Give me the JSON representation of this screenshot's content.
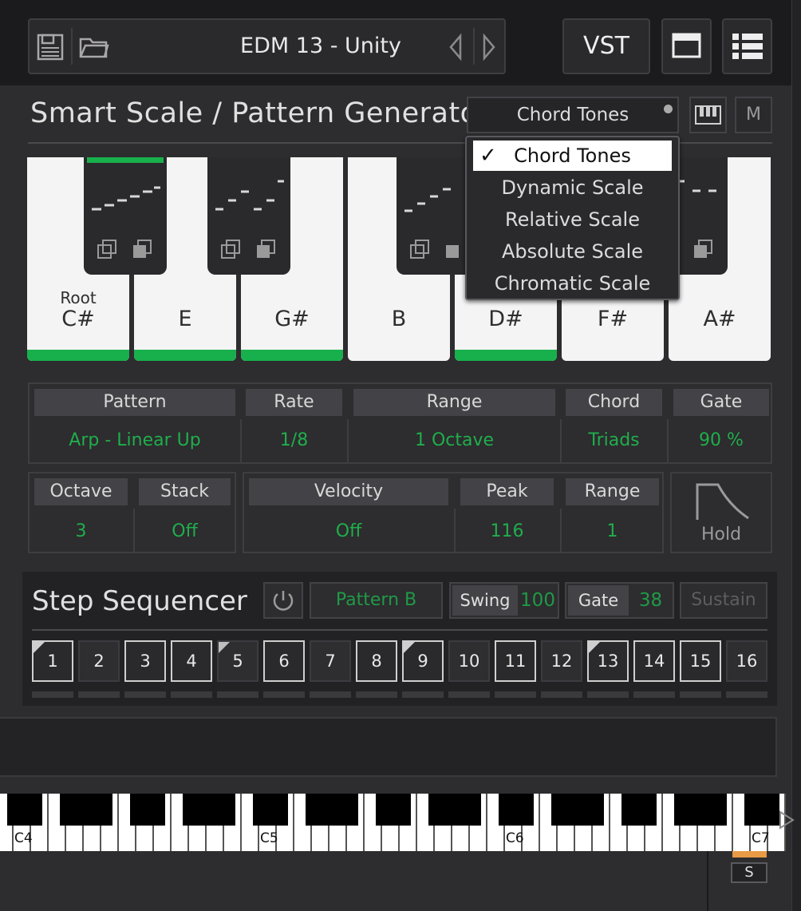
{
  "header": {
    "preset_name": "EDM 13 - Unity",
    "vst_label": "VST",
    "icons": [
      "save-icon",
      "folder-icon",
      "prev-arrow-icon",
      "next-arrow-icon",
      "window-icon",
      "list-icon"
    ]
  },
  "generator": {
    "title": "Smart Scale / Pattern Generator",
    "mode": "Chord Tones",
    "m_label": "M",
    "dropdown": [
      "Chord Tones",
      "Dynamic Scale",
      "Relative Scale",
      "Absolute Scale",
      "Chromatic Scale"
    ],
    "selected_index": 0,
    "check": "✓",
    "root_label": "Root",
    "keys": [
      {
        "note": "C#",
        "active": true
      },
      {
        "note": "E",
        "active": true
      },
      {
        "note": "G#",
        "active": true
      },
      {
        "note": "B",
        "active": false
      },
      {
        "note": "D#",
        "active": true
      },
      {
        "note": "F#",
        "active": false
      },
      {
        "note": "A#",
        "active": false
      }
    ],
    "accent_color": "#18b04c"
  },
  "params1": {
    "pattern": {
      "label": "Pattern",
      "value": "Arp - Linear Up"
    },
    "rate": {
      "label": "Rate",
      "value": "1/8"
    },
    "range": {
      "label": "Range",
      "value": "1 Octave"
    },
    "chord": {
      "label": "Chord",
      "value": "Triads"
    },
    "gate": {
      "label": "Gate",
      "value": "90 %"
    }
  },
  "params2": {
    "octave": {
      "label": "Octave",
      "value": "3"
    },
    "stack": {
      "label": "Stack",
      "value": "Off"
    },
    "velocity": {
      "label": "Velocity",
      "value": "Off"
    },
    "peak": {
      "label": "Peak",
      "value": "116"
    },
    "range": {
      "label": "Range",
      "value": "1"
    },
    "hold_label": "Hold"
  },
  "sequencer": {
    "title": "Step Sequencer",
    "pattern": "Pattern B",
    "swing_label": "Swing",
    "swing_value": "100",
    "gate_label": "Gate",
    "gate_value": "38",
    "sustain_label": "Sustain",
    "steps": [
      "1",
      "2",
      "3",
      "4",
      "5",
      "6",
      "7",
      "8",
      "9",
      "10",
      "11",
      "12",
      "13",
      "14",
      "15",
      "16"
    ]
  },
  "keyboard": {
    "labels": [
      "C4",
      "C5",
      "C6",
      "C7"
    ]
  },
  "footer": {
    "s_label": "S"
  }
}
